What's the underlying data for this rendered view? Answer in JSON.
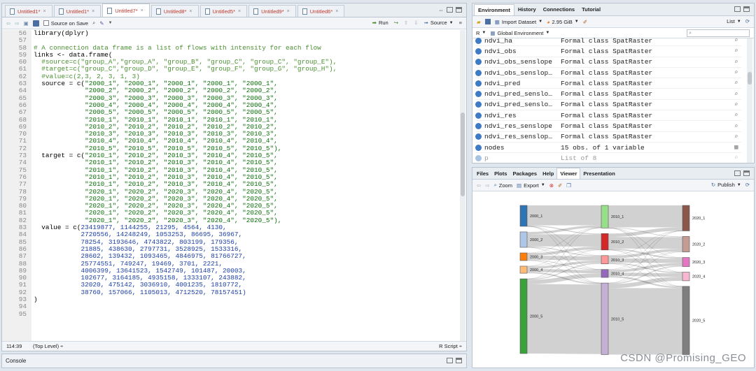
{
  "editor": {
    "tabs": [
      {
        "label": "Untitled1*"
      },
      {
        "label": "Untitled1*"
      },
      {
        "label": "Untitled7*"
      },
      {
        "label": "Untitled8*"
      },
      {
        "label": "Untitled5*"
      },
      {
        "label": "Untitled9*"
      },
      {
        "label": "Untitled6*"
      }
    ],
    "source_on_save": "Source on Save",
    "run": "Run",
    "source": "Source",
    "lines": [
      {
        "n": "56",
        "segs": [
          {
            "t": "library(dplyr)",
            "c": "fn"
          }
        ]
      },
      {
        "n": "57",
        "segs": []
      },
      {
        "n": "58",
        "segs": [
          {
            "t": "# A connection data frame is a list of flows with intensity for each flow",
            "c": "cmt"
          }
        ]
      },
      {
        "n": "59",
        "segs": [
          {
            "t": "links <- data.frame(",
            "c": "fn"
          }
        ]
      },
      {
        "n": "60",
        "segs": [
          {
            "t": "  #source=c(\"group_A\",\"group_A\", \"group_B\", \"group_C\", \"group_C\", \"group_E\"),",
            "c": "cmt"
          }
        ]
      },
      {
        "n": "61",
        "segs": [
          {
            "t": "  #target=c(\"group_C\",\"group_D\", \"group_E\", \"group_F\", \"group_G\", \"group_H\"),",
            "c": "cmt"
          }
        ]
      },
      {
        "n": "62",
        "segs": [
          {
            "t": "  #value=c(2,3, 2, 3, 1, 3)",
            "c": "cmt"
          }
        ]
      },
      {
        "n": "63",
        "segs": [
          {
            "t": "  source = c(",
            "c": "fn"
          },
          {
            "t": "\"2000_1\", \"2000_1\", \"2000_1\", \"2000_1\", \"2000_1\",",
            "c": "str"
          }
        ]
      },
      {
        "n": "64",
        "segs": [
          {
            "t": "             ",
            "c": "fn"
          },
          {
            "t": "\"2000_2\", \"2000_2\", \"2000_2\", \"2000_2\", \"2000_2\",",
            "c": "str"
          }
        ]
      },
      {
        "n": "65",
        "segs": [
          {
            "t": "             ",
            "c": "fn"
          },
          {
            "t": "\"2000_3\", \"2000_3\", \"2000_3\", \"2000_3\", \"2000_3\",",
            "c": "str"
          }
        ]
      },
      {
        "n": "66",
        "segs": [
          {
            "t": "             ",
            "c": "fn"
          },
          {
            "t": "\"2000_4\", \"2000_4\", \"2000_4\", \"2000_4\", \"2000_4\",",
            "c": "str"
          }
        ]
      },
      {
        "n": "67",
        "segs": [
          {
            "t": "             ",
            "c": "fn"
          },
          {
            "t": "\"2000_5\", \"2000_5\", \"2000_5\", \"2000_5\", \"2000_5\",",
            "c": "str"
          }
        ]
      },
      {
        "n": "68",
        "segs": [
          {
            "t": "             ",
            "c": "fn"
          },
          {
            "t": "\"2010_1\", \"2010_1\", \"2010_1\", \"2010_1\", \"2010_1\",",
            "c": "str"
          }
        ]
      },
      {
        "n": "69",
        "segs": [
          {
            "t": "             ",
            "c": "fn"
          },
          {
            "t": "\"2010_2\", \"2010_2\", \"2010_2\", \"2010_2\", \"2010_2\",",
            "c": "str"
          }
        ]
      },
      {
        "n": "70",
        "segs": [
          {
            "t": "             ",
            "c": "fn"
          },
          {
            "t": "\"2010_3\", \"2010_3\", \"2010_3\", \"2010_3\", \"2010_3\",",
            "c": "str"
          }
        ]
      },
      {
        "n": "71",
        "segs": [
          {
            "t": "             ",
            "c": "fn"
          },
          {
            "t": "\"2010_4\", \"2010_4\", \"2010_4\", \"2010_4\", \"2010_4\",",
            "c": "str"
          }
        ]
      },
      {
        "n": "72",
        "segs": [
          {
            "t": "             ",
            "c": "fn"
          },
          {
            "t": "\"2010_5\", \"2010_5\", \"2010_5\", \"2010_5\", \"2010_5\"),",
            "c": "str"
          }
        ]
      },
      {
        "n": "73",
        "segs": [
          {
            "t": "  target = c(",
            "c": "fn"
          },
          {
            "t": "\"2010_1\", \"2010_2\", \"2010_3\", \"2010_4\", \"2010_5\",",
            "c": "str"
          }
        ]
      },
      {
        "n": "74",
        "segs": [
          {
            "t": "             ",
            "c": "fn"
          },
          {
            "t": "\"2010_1\", \"2010_2\", \"2010_3\", \"2010_4\", \"2010_5\",",
            "c": "str"
          }
        ]
      },
      {
        "n": "75",
        "segs": [
          {
            "t": "             ",
            "c": "fn"
          },
          {
            "t": "\"2010_1\", \"2010_2\", \"2010_3\", \"2010_4\", \"2010_5\",",
            "c": "str"
          }
        ]
      },
      {
        "n": "76",
        "segs": [
          {
            "t": "             ",
            "c": "fn"
          },
          {
            "t": "\"2010_1\", \"2010_2\", \"2010_3\", \"2010_4\", \"2010_5\",",
            "c": "str"
          }
        ]
      },
      {
        "n": "77",
        "segs": [
          {
            "t": "             ",
            "c": "fn"
          },
          {
            "t": "\"2010_1\", \"2010_2\", \"2010_3\", \"2010_4\", \"2010_5\",",
            "c": "str"
          }
        ]
      },
      {
        "n": "78",
        "segs": [
          {
            "t": "             ",
            "c": "fn"
          },
          {
            "t": "\"2020_1\", \"2020_2\", \"2020_3\", \"2020_4\", \"2020_5\",",
            "c": "str"
          }
        ]
      },
      {
        "n": "79",
        "segs": [
          {
            "t": "             ",
            "c": "fn"
          },
          {
            "t": "\"2020_1\", \"2020_2\", \"2020_3\", \"2020_4\", \"2020_5\",",
            "c": "str"
          }
        ]
      },
      {
        "n": "80",
        "segs": [
          {
            "t": "             ",
            "c": "fn"
          },
          {
            "t": "\"2020_1\", \"2020_2\", \"2020_3\", \"2020_4\", \"2020_5\",",
            "c": "str"
          }
        ]
      },
      {
        "n": "81",
        "segs": [
          {
            "t": "             ",
            "c": "fn"
          },
          {
            "t": "\"2020_1\", \"2020_2\", \"2020_3\", \"2020_4\", \"2020_5\",",
            "c": "str"
          }
        ]
      },
      {
        "n": "82",
        "segs": [
          {
            "t": "             ",
            "c": "fn"
          },
          {
            "t": "\"2020_1\", \"2020_2\", \"2020_3\", \"2020_4\", \"2020_5\"),",
            "c": "str"
          }
        ]
      },
      {
        "n": "83",
        "segs": [
          {
            "t": "  value = c(",
            "c": "fn"
          },
          {
            "t": "23419877, 1144255, 21295, 4564, 4130,",
            "c": "num"
          }
        ]
      },
      {
        "n": "84",
        "segs": [
          {
            "t": "            ",
            "c": "fn"
          },
          {
            "t": "2720556, 14248249, 1053253, 86695, 36967,",
            "c": "num"
          }
        ]
      },
      {
        "n": "85",
        "segs": [
          {
            "t": "            ",
            "c": "fn"
          },
          {
            "t": "78254, 3193646, 4743822, 803199, 179356,",
            "c": "num"
          }
        ]
      },
      {
        "n": "86",
        "segs": [
          {
            "t": "            ",
            "c": "fn"
          },
          {
            "t": "21885, 438630, 2797731, 3528925, 1533316,",
            "c": "num"
          }
        ]
      },
      {
        "n": "87",
        "segs": [
          {
            "t": "            ",
            "c": "fn"
          },
          {
            "t": "28602, 139432, 1093465, 4846975, 81766727,",
            "c": "num"
          }
        ]
      },
      {
        "n": "88",
        "segs": [
          {
            "t": "            ",
            "c": "fn"
          },
          {
            "t": "25774551, 749247, 19469, 3701, 2221,",
            "c": "num"
          }
        ]
      },
      {
        "n": "89",
        "segs": [
          {
            "t": "            ",
            "c": "fn"
          },
          {
            "t": "4006399, 13641523, 1542749, 101487, 20003,",
            "c": "num"
          }
        ]
      },
      {
        "n": "90",
        "segs": [
          {
            "t": "            ",
            "c": "fn"
          },
          {
            "t": "102677, 3164185, 4935158, 1333107, 243882,",
            "c": "num"
          }
        ]
      },
      {
        "n": "91",
        "segs": [
          {
            "t": "            ",
            "c": "fn"
          },
          {
            "t": "32020, 475142, 3036910, 4001235, 1810772,",
            "c": "num"
          }
        ]
      },
      {
        "n": "92",
        "segs": [
          {
            "t": "            ",
            "c": "fn"
          },
          {
            "t": "38760, 157066, 1105013, 4712520, 78157451)",
            "c": "num"
          }
        ]
      },
      {
        "n": "93",
        "segs": [
          {
            "t": ")",
            "c": "fn"
          }
        ]
      },
      {
        "n": "94",
        "segs": []
      },
      {
        "n": "95",
        "segs": []
      }
    ],
    "status_pos": "114:39",
    "status_level": "(Top Level) ÷",
    "status_type": "R Script ÷"
  },
  "console": {
    "label": "Console"
  },
  "env": {
    "tabs": [
      "Environment",
      "History",
      "Connections",
      "Tutorial"
    ],
    "import_dataset": "Import Dataset",
    "memory": "2.95 GiB",
    "list_view": "List",
    "lang": "R",
    "scope": "Global Environment",
    "rows": [
      {
        "name": "ndvi_ha",
        "value": "Formal class  SpatRaster"
      },
      {
        "name": "ndvi_obs",
        "value": "Formal class  SpatRaster"
      },
      {
        "name": "ndvi_obs_senslope",
        "value": "Formal class  SpatRaster"
      },
      {
        "name": "ndvi_obs_senslop…",
        "value": "Formal class  SpatRaster"
      },
      {
        "name": "ndvi_pred",
        "value": "Formal class  SpatRaster"
      },
      {
        "name": "ndvi_pred_senslo…",
        "value": "Formal class  SpatRaster"
      },
      {
        "name": "ndvi_pred_senslo…",
        "value": "Formal class  SpatRaster"
      },
      {
        "name": "ndvi_res",
        "value": "Formal class  SpatRaster"
      },
      {
        "name": "ndvi_res_senslope",
        "value": "Formal class  SpatRaster"
      },
      {
        "name": "ndvi_res_senslop…",
        "value": "Formal class  SpatRaster"
      },
      {
        "name": "nodes",
        "value": "15 obs. of 1 variable"
      },
      {
        "name": "p",
        "value": "List of  8"
      }
    ]
  },
  "viewer": {
    "tabs": [
      "Files",
      "Plots",
      "Packages",
      "Help",
      "Viewer",
      "Presentation"
    ],
    "zoom": "Zoom",
    "export": "Export",
    "publish": "Publish"
  },
  "sankey": {
    "colors": {
      "2000_1": "#2e75b6",
      "2000_2": "#aec7e8",
      "2000_3": "#ff7f0e",
      "2000_4": "#ffbb78",
      "2000_5": "#3aa23a",
      "2010_1": "#98df8a",
      "2010_2": "#d62728",
      "2010_3": "#ff9896",
      "2010_4": "#9467bd",
      "2010_5": "#c5b0d5",
      "2020_1": "#8c564b",
      "2020_2": "#c49c94",
      "2020_3": "#e377c2",
      "2020_4": "#f7b6d2",
      "2020_5": "#7f7f7f"
    },
    "nodes_2000": [
      "2000_1",
      "2000_2",
      "2000_3",
      "2000_4",
      "2000_5"
    ],
    "nodes_2010": [
      "2010_1",
      "2010_2",
      "2010_3",
      "2010_4",
      "2010_5"
    ],
    "nodes_2020": [
      "2020_1",
      "2020_2",
      "2020_3",
      "2020_4",
      "2020_5"
    ],
    "flows_2000_to_2010": [
      [
        23419877,
        1144255,
        21295,
        4564,
        4130
      ],
      [
        2720556,
        14248249,
        1053253,
        86695,
        36967
      ],
      [
        78254,
        3193646,
        4743822,
        803199,
        179356
      ],
      [
        21885,
        438630,
        2797731,
        3528925,
        1533316
      ],
      [
        28602,
        139432,
        1093465,
        4846975,
        81766727
      ]
    ],
    "flows_2010_to_2020": [
      [
        25774551,
        749247,
        19469,
        3701,
        2221
      ],
      [
        4006399,
        13641523,
        1542749,
        101487,
        20003
      ],
      [
        102677,
        3164185,
        4935158,
        1333107,
        243882
      ],
      [
        32020,
        475142,
        3036910,
        4001235,
        1810772
      ],
      [
        38760,
        157066,
        1105013,
        4712520,
        78157451
      ]
    ]
  },
  "watermark": "CSDN @Promising_GEO"
}
